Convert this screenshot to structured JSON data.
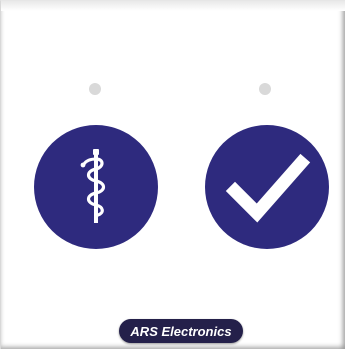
{
  "device_panel": {
    "brand_label": "ARS Electronics",
    "left_button": {
      "icon": "medical-staff-icon"
    },
    "right_button": {
      "icon": "checkmark-icon"
    },
    "indicators": [
      {
        "state": "off",
        "color": "#d9d9d9"
      },
      {
        "state": "off",
        "color": "#d9d9d9"
      }
    ]
  },
  "colors": {
    "button_bg": "#2e2a7e",
    "icon_fg": "#ffffff",
    "badge_bg": "#24204a",
    "panel_bg": "#ffffff"
  }
}
